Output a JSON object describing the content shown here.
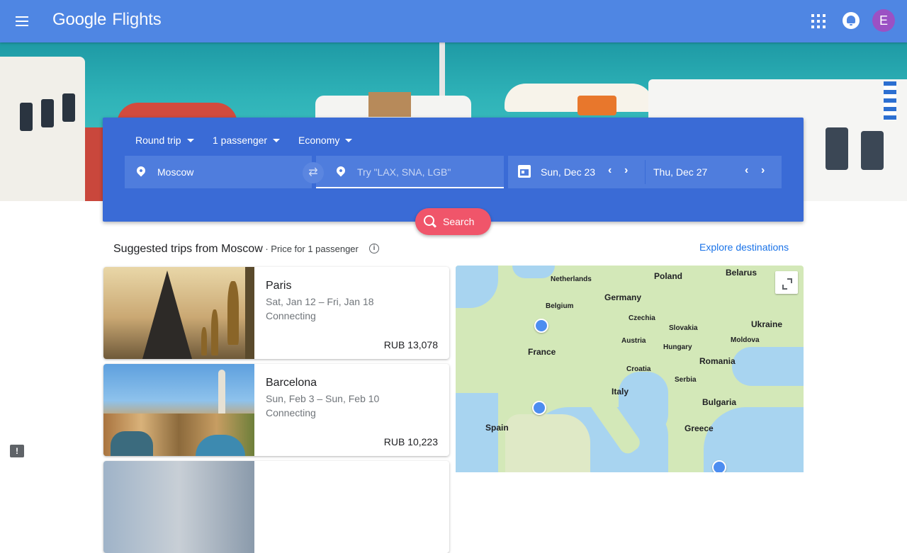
{
  "header": {
    "logo_google": "Google",
    "logo_product": "Flights",
    "avatar_initial": "E",
    "icons": [
      "menu-icon",
      "apps-icon",
      "notifications-icon"
    ]
  },
  "search": {
    "trip_type": "Round trip",
    "passengers": "1 passenger",
    "cabin": "Economy",
    "origin": "Moscow",
    "destination_placeholder": "Try \"LAX, SNA, LGB\"",
    "depart_date": "Sun, Dec 23",
    "return_date": "Thu, Dec 27",
    "search_label": "Search"
  },
  "suggested": {
    "title": "Suggested trips from Moscow",
    "subtitle": " · Price for 1 passenger",
    "explore_label": "Explore destinations",
    "trips": [
      {
        "city": "Paris",
        "dates": "Sat, Jan 12 – Fri, Jan 18",
        "stops": "Connecting",
        "price": "RUB 13,078"
      },
      {
        "city": "Barcelona",
        "dates": "Sun, Feb 3 – Sun, Feb 10",
        "stops": "Connecting",
        "price": "RUB 10,223"
      }
    ]
  },
  "map": {
    "labels": {
      "netherlands": "Netherlands",
      "poland": "Poland",
      "belarus": "Belarus",
      "germany": "Germany",
      "belgium": "Belgium",
      "czechia": "Czechia",
      "slovakia": "Slovakia",
      "ukraine": "Ukraine",
      "austria": "Austria",
      "moldova": "Moldova",
      "france": "France",
      "hungary": "Hungary",
      "romania": "Romania",
      "croatia": "Croatia",
      "serbia": "Serbia",
      "italy": "Italy",
      "bulgaria": "Bulgaria",
      "spain": "Spain",
      "greece": "Greece"
    }
  },
  "colors": {
    "appbar": "#4f86e3",
    "search_card": "#3a6bd6",
    "search_button": "#f0556a",
    "link": "#1a73e8",
    "avatar": "#9b51c4"
  }
}
